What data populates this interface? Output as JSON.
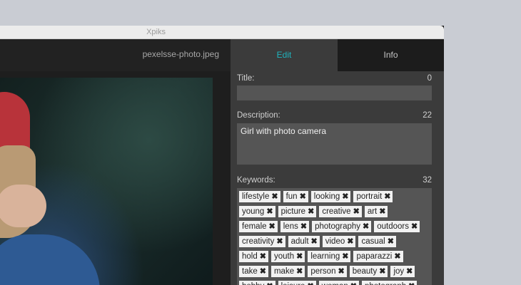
{
  "window": {
    "title": "Xpiks"
  },
  "preview": {
    "filename": "pexelsse-photo.jpeg"
  },
  "tabs": {
    "edit": "Edit",
    "info": "Info"
  },
  "fields": {
    "title_label": "Title:",
    "title_count": "0",
    "title_value": "",
    "description_label": "Description:",
    "description_count": "22",
    "description_value": "Girl with photo camera",
    "keywords_label": "Keywords:",
    "keywords_count": "32"
  },
  "keyword_rows": [
    [
      "lifestyle",
      "fun",
      "looking",
      "portrait"
    ],
    [
      "young",
      "picture",
      "creative",
      "art"
    ],
    [
      "female",
      "lens",
      "photography",
      "outdoors"
    ],
    [
      "creativity",
      "adult",
      "video",
      "casual"
    ],
    [
      "hold",
      "youth",
      "learning",
      "paparazzi"
    ],
    [
      "take",
      "make",
      "person",
      "beauty",
      "joy"
    ],
    [
      "hobby",
      "leisure",
      "woman",
      "photograph"
    ]
  ],
  "icons": {
    "remove": "close-icon",
    "remove_glyph": "✖"
  },
  "colors": {
    "accent": "#1fb3bd",
    "panel": "#3b3b3b",
    "field": "#555555",
    "tag": "#f2f2f2"
  }
}
